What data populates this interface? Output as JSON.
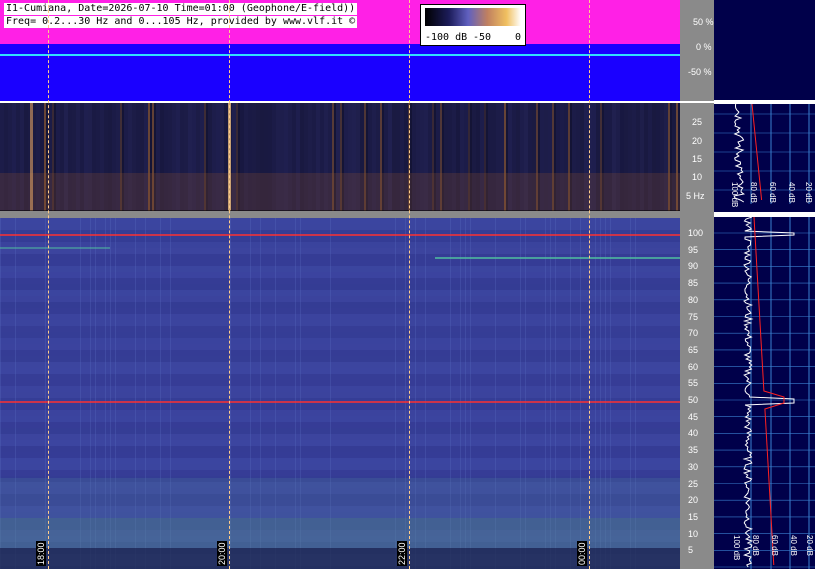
{
  "header": {
    "line1": "I1-Cumiana, Date=2026-07-10 Time=01:00 (Geophone/E-field))",
    "line2": "Freq= 0.2...30 Hz and 0...105 Hz, provided by www.vlf.it ©"
  },
  "legend": {
    "min_label": "-100 dB",
    "mid_label": "-50",
    "max_label": "0"
  },
  "wave_axis": [
    "50 %",
    "0 %",
    "-50 %"
  ],
  "small_axis": [
    "25",
    "20",
    "15",
    "10",
    "5 Hz"
  ],
  "big_axis": [
    "100",
    "95",
    "90",
    "85",
    "80",
    "75",
    "70",
    "65",
    "60",
    "55",
    "50",
    "45",
    "40",
    "35",
    "30",
    "25",
    "20",
    "15",
    "10",
    "5"
  ],
  "time_labels": [
    "18:00",
    "20:00",
    "22:00",
    "00:00"
  ],
  "profile_small_axis": [
    "100 dB",
    "80 dB",
    "60 dB",
    "40 dB",
    "20 dB"
  ],
  "profile_big_axis": [
    "100 dB",
    "80 dB",
    "60 dB",
    "40 dB",
    "20 dB"
  ],
  "colors": {
    "wave_bg": "#1a00ff",
    "wave_envelope": "#ff20e6",
    "wave_trace": "#31e0ff",
    "spectrogram_bg": "#3a3f9a",
    "mains_line": "#ff3030",
    "grid_time": "#ffcc88",
    "profile_bg": "#00004a"
  }
}
